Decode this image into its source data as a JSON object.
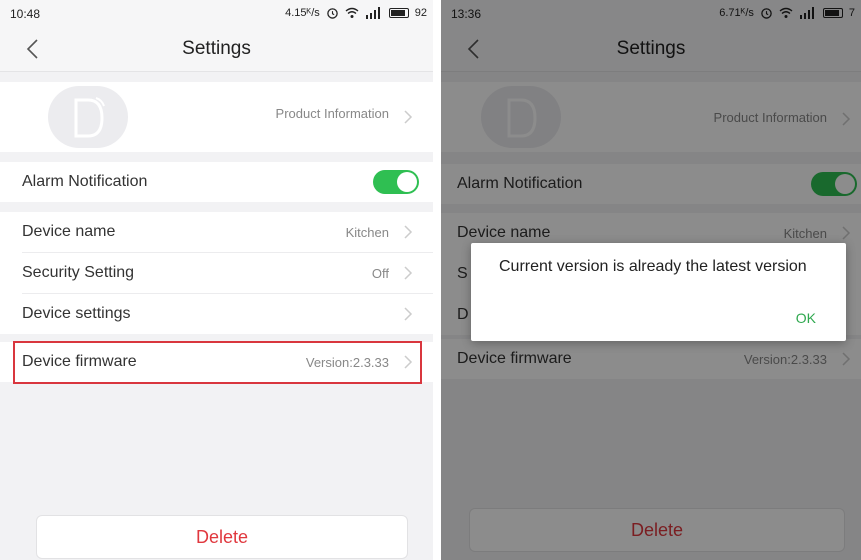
{
  "left": {
    "status": {
      "time": "10:48",
      "speed": "4.15ᴷ/s",
      "battery": "92"
    },
    "nav": {
      "title": "Settings"
    },
    "product_info": "Product Information",
    "alarm_label": "Alarm Notification",
    "alarm_on": true,
    "rows": {
      "device_name_label": "Device name",
      "device_name_value": "Kitchen",
      "security_label": "Security Setting",
      "security_value": "Off",
      "device_settings_label": "Device settings",
      "firmware_label": "Device firmware",
      "firmware_value": "Version:2.3.33"
    },
    "delete_label": "Delete"
  },
  "right": {
    "status": {
      "time": "13:36",
      "speed": "6.71ᴷ/s",
      "battery": "7"
    },
    "nav": {
      "title": "Settings"
    },
    "product_info": "Product Information",
    "alarm_label": "Alarm Notification",
    "rows": {
      "device_name_label": "Device name",
      "device_name_value": "Kitchen",
      "security_label_partial": "S",
      "device_settings_label_partial": "D",
      "firmware_label": "Device firmware",
      "firmware_value": "Version:2.3.33"
    },
    "dialog": {
      "message": "Current version is already the latest version",
      "ok_label": "OK"
    },
    "delete_label": "Delete"
  },
  "colors": {
    "accent_green": "#2fbf52",
    "delete_red": "#e0383e",
    "highlight_red": "#d9363e"
  }
}
